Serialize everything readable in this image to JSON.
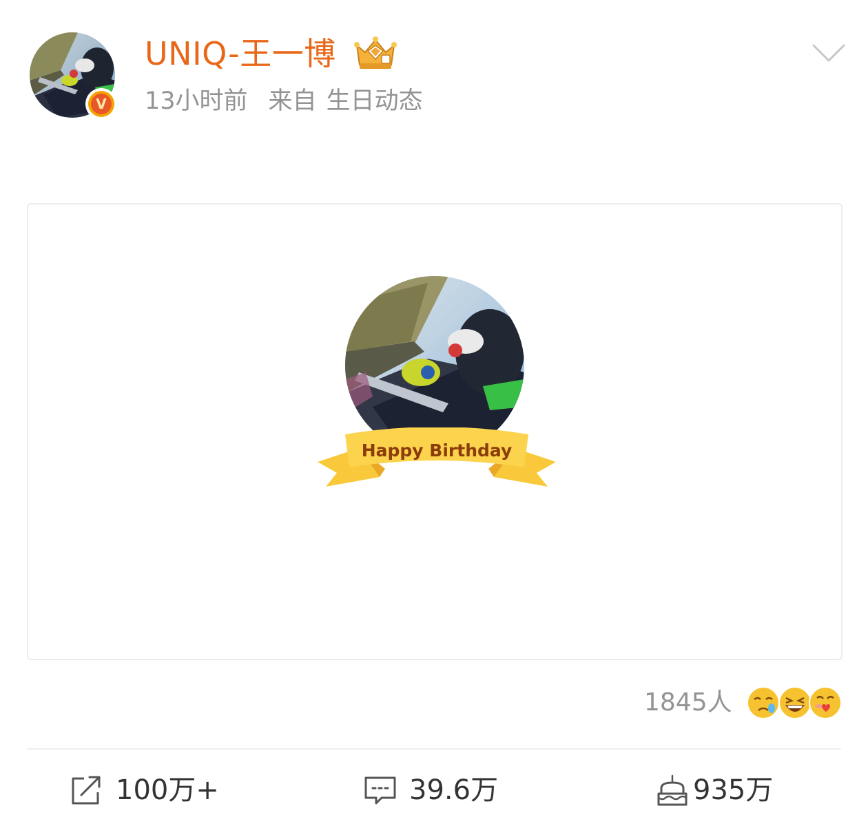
{
  "post": {
    "author": {
      "name": "UNIQ-王一博",
      "avatar_icon": "motorcycle-rider-avatar",
      "verified_badge": "V",
      "verified_color": "#e8562a",
      "crown_icon": "crown-icon"
    },
    "meta": {
      "time": "13小时前",
      "source_label": "来自",
      "source": "生日动态"
    },
    "menu_icon": "chevron-down-icon",
    "card": {
      "ribbon_text": "Happy Birthday",
      "photo_icon": "motorcycle-rider-photo"
    },
    "reactions": {
      "count_text": "1845人",
      "emojis": [
        "tearful-emoji",
        "laughing-emoji",
        "kiss-emoji"
      ]
    },
    "actions": {
      "repost": {
        "icon": "share-icon",
        "count": "100万+"
      },
      "comment": {
        "icon": "comment-icon",
        "count": "39.6万"
      },
      "like": {
        "icon": "birthday-cake-icon",
        "count": "935万"
      }
    }
  },
  "colors": {
    "name": "#e8681a",
    "meta": "#939393",
    "count": "#333333",
    "ribbon": "#f9c93b",
    "ribbon_text": "#8a3c0a"
  }
}
